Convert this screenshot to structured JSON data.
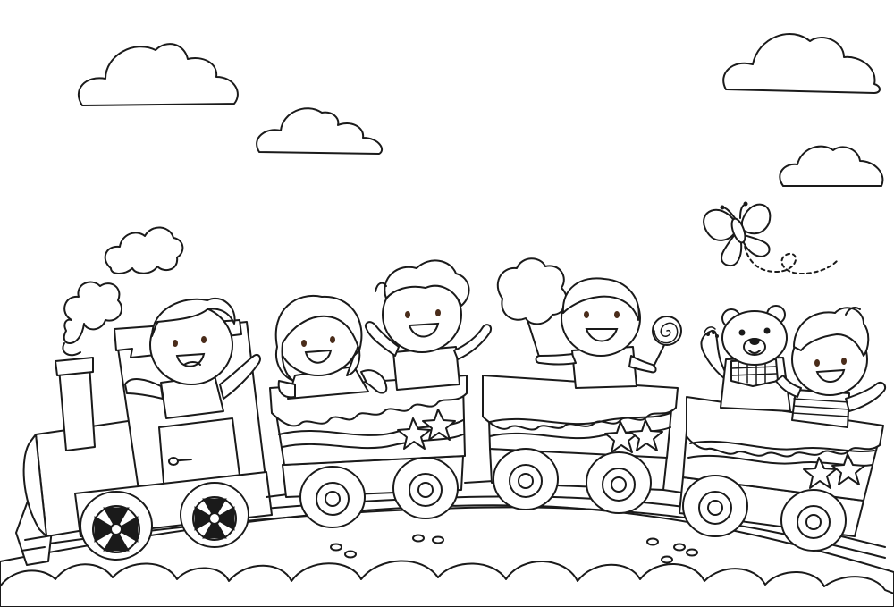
{
  "scene": {
    "line_color": "#1a1a1a",
    "background_color": "#ffffff",
    "eye_color": "#4a2c1a"
  }
}
